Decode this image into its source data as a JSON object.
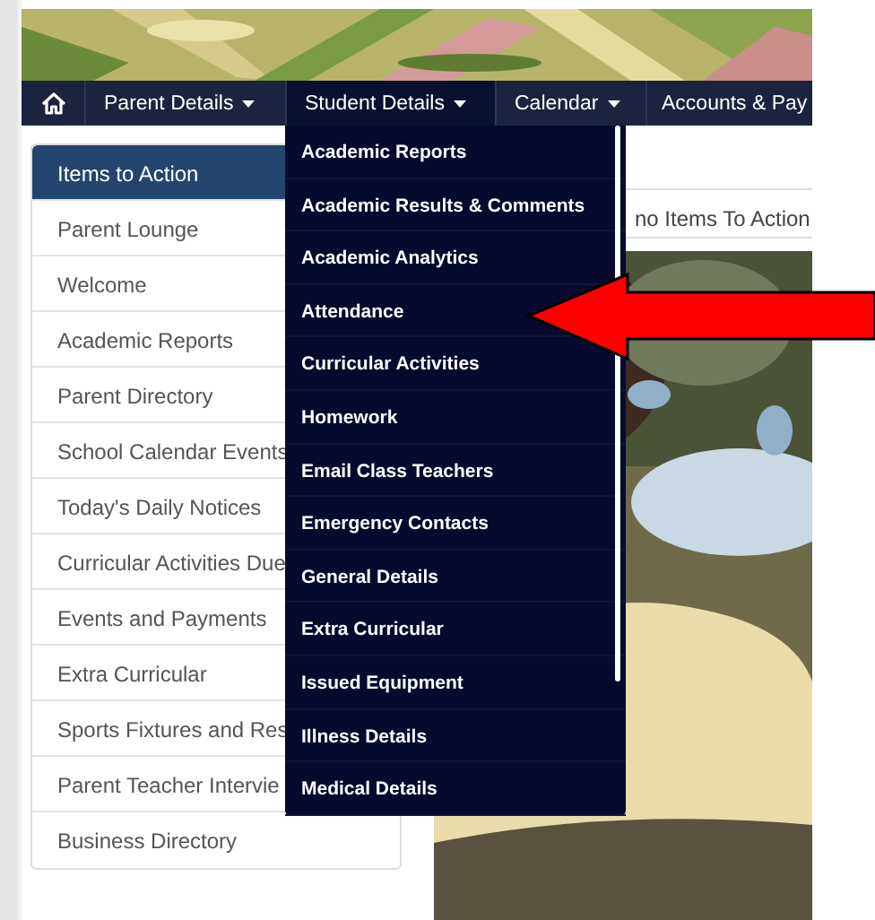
{
  "nav": {
    "items": [
      {
        "kind": "home",
        "selected": false
      },
      {
        "kind": "menu",
        "label": "Parent Details",
        "dropdown": true,
        "selected": false
      },
      {
        "kind": "menu",
        "label": "Student Details",
        "dropdown": true,
        "selected": true
      },
      {
        "kind": "menu",
        "label": "Calendar",
        "dropdown": true,
        "selected": false
      },
      {
        "kind": "menu",
        "label": "Accounts & Pay",
        "dropdown": false,
        "selected": false
      }
    ]
  },
  "sidebar": {
    "items": [
      {
        "label": "Items to Action",
        "selected": true
      },
      {
        "label": "Parent Lounge",
        "selected": false
      },
      {
        "label": "Welcome",
        "selected": false
      },
      {
        "label": "Academic Reports",
        "selected": false
      },
      {
        "label": "Parent Directory",
        "selected": false
      },
      {
        "label": "School Calendar Events",
        "selected": false
      },
      {
        "label": "Today's Daily Notices",
        "selected": false
      },
      {
        "label": "Curricular Activities Due",
        "selected": false
      },
      {
        "label": "Events and Payments",
        "selected": false
      },
      {
        "label": "Extra Curricular",
        "selected": false
      },
      {
        "label": "Sports Fixtures and Res",
        "selected": false
      },
      {
        "label": "Parent Teacher Intervie",
        "selected": false
      },
      {
        "label": "Business Directory",
        "selected": false
      }
    ]
  },
  "dropdown_menu": {
    "items": [
      "Academic Reports",
      "Academic Results & Comments",
      "Academic Analytics",
      "Attendance",
      "Curricular Activities",
      "Homework",
      "Email Class Teachers",
      "Emergency Contacts",
      "General Details",
      "Extra Curricular",
      "Issued Equipment",
      "Illness Details",
      "Medical Details"
    ]
  },
  "content": {
    "message": "no Items To Action"
  }
}
